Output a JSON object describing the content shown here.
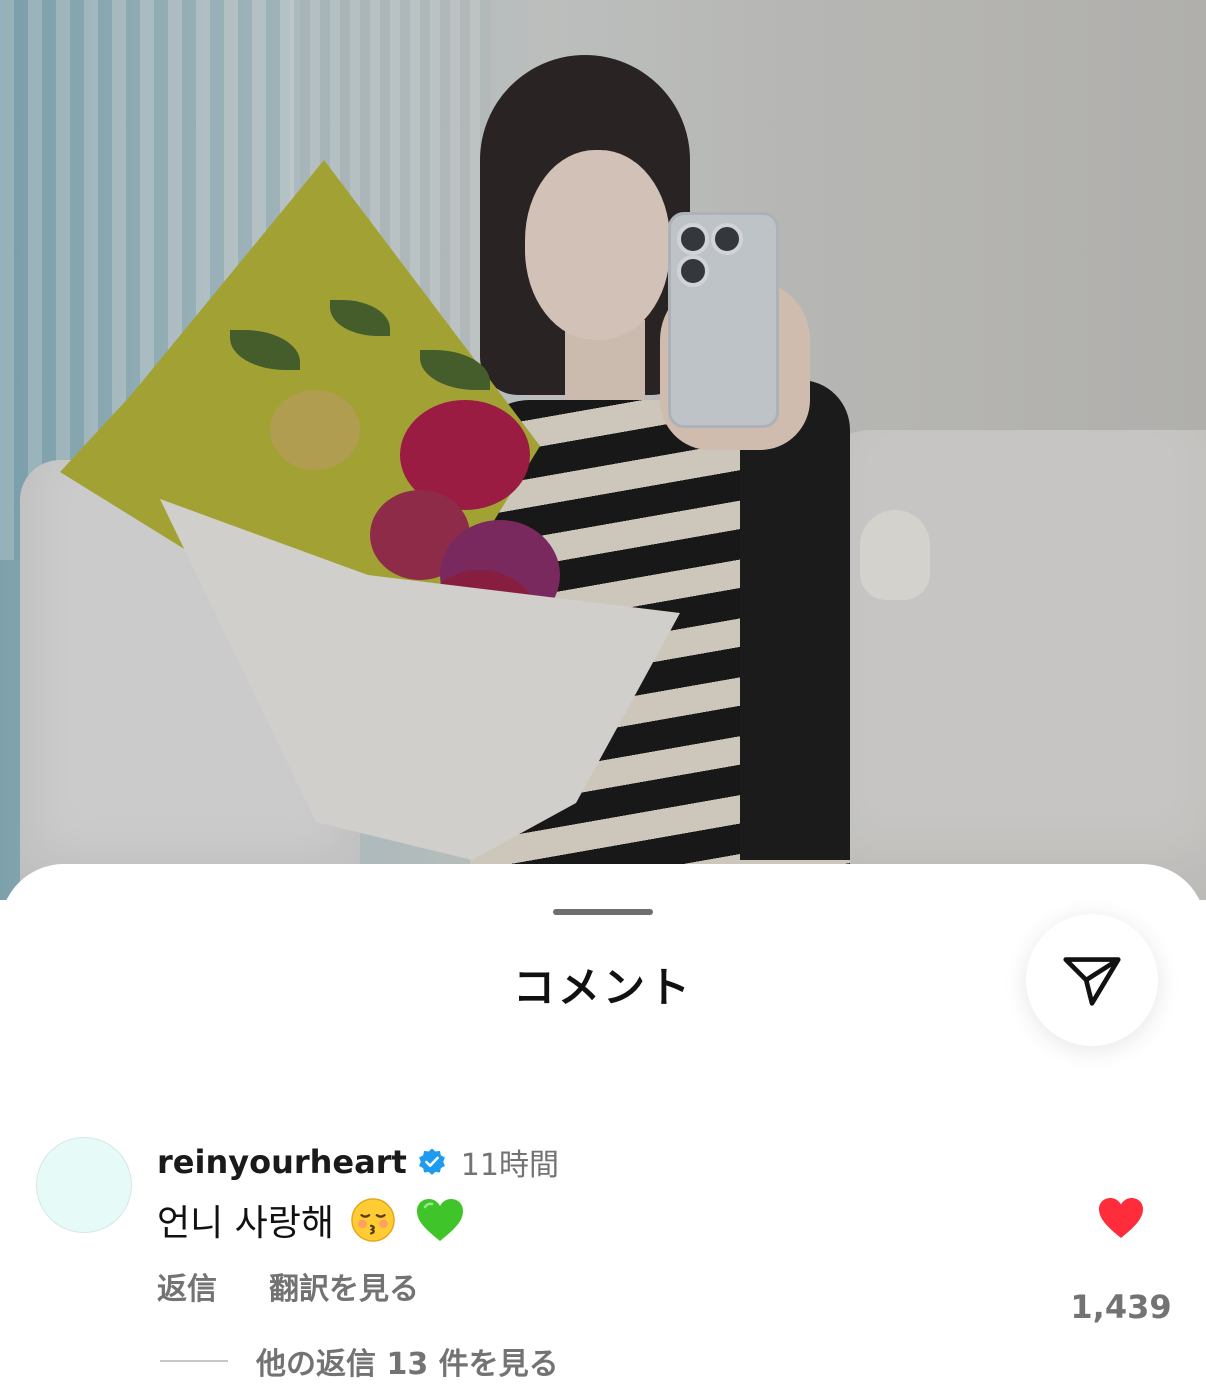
{
  "sheet": {
    "title": "コメント",
    "share_icon": "send-icon"
  },
  "comment": {
    "username": "reinyourheart",
    "verified": true,
    "time": "11時間",
    "text": "언니 사랑해",
    "emojis": [
      "kissing-face-emoji",
      "green-heart-emoji"
    ],
    "reply_label": "返信",
    "translate_label": "翻訳を見る",
    "like_count": "1,439",
    "liked": true,
    "view_replies_label": "他の返信 13 件を見る"
  },
  "colors": {
    "like_red": "#ff2d3b",
    "verified_blue": "#1d9bf0",
    "secondary_text": "#737373",
    "avatar_bg": "#e6fbf7"
  }
}
